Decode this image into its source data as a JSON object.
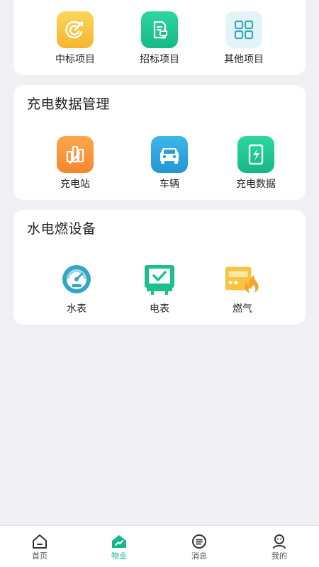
{
  "projects": {
    "items": [
      {
        "label": "中标项目",
        "icon": "target-moon-icon",
        "color": "#f8c13a"
      },
      {
        "label": "招标项目",
        "icon": "document-edit-icon",
        "color": "#1fc78f"
      },
      {
        "label": "其他项目",
        "icon": "grid-apps-icon",
        "color": "#e4f5f7"
      }
    ]
  },
  "charging": {
    "title": "充电数据管理",
    "items": [
      {
        "label": "充电站",
        "icon": "bar-chart-icon",
        "color": "#f8943a"
      },
      {
        "label": "车辆",
        "icon": "car-icon",
        "color": "#2fa7de"
      },
      {
        "label": "充电数据",
        "icon": "battery-charge-icon",
        "color": "#1fc78f"
      }
    ]
  },
  "utilities": {
    "title": "水电燃设备",
    "items": [
      {
        "label": "水表",
        "icon": "gauge-icon",
        "color": "#34a6c4"
      },
      {
        "label": "电表",
        "icon": "monitor-check-icon",
        "color": "#1cc08f"
      },
      {
        "label": "燃气",
        "icon": "gas-flame-icon",
        "color": "#f7c341"
      }
    ]
  },
  "tabbar": {
    "tabs": [
      {
        "label": "首页",
        "icon": "home-icon",
        "active": false
      },
      {
        "label": "物业",
        "icon": "property-icon",
        "active": true
      },
      {
        "label": "消息",
        "icon": "message-icon",
        "active": false
      },
      {
        "label": "我的",
        "icon": "profile-icon",
        "active": false
      }
    ],
    "active_color": "#14b889"
  }
}
